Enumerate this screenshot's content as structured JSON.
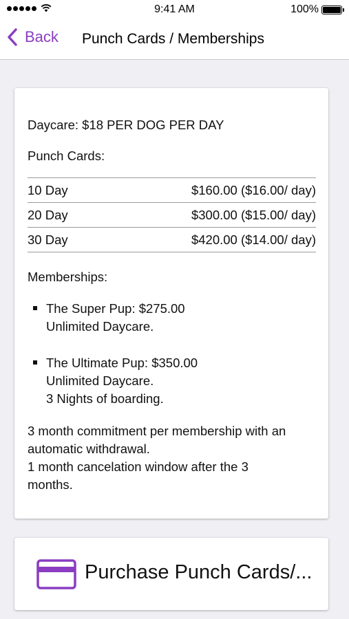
{
  "status_bar": {
    "time": "9:41 AM",
    "battery": "100%"
  },
  "nav": {
    "back_label": "Back",
    "title": "Punch Cards / Memberships"
  },
  "card": {
    "daycare_rate": "Daycare: $18 PER DOG PER DAY",
    "punch_heading": "Punch Cards:",
    "punch_cards": [
      {
        "label": "10 Day",
        "price": "$160.00 ($16.00/ day)"
      },
      {
        "label": "20 Day",
        "price": "$300.00 ($15.00/ day)"
      },
      {
        "label": "30 Day",
        "price": "$420.00 ($14.00/ day)"
      }
    ],
    "memberships_heading": "Memberships:",
    "memberships": [
      {
        "name": "The Super Pup: $275.00",
        "lines": [
          "Unlimited Daycare."
        ]
      },
      {
        "name": "The Ultimate Pup: $350.00",
        "lines": [
          "Unlimited Daycare.",
          "3 Nights of boarding."
        ]
      }
    ],
    "commitment_lines": [
      "3 month commitment per membership with an",
      "automatic withdrawal.",
      "1 month cancelation window after the 3",
      "months."
    ]
  },
  "purchase": {
    "label": "Purchase Punch Cards/..."
  },
  "colors": {
    "accent": "#8a3dc1",
    "background": "#efeff4"
  },
  "icons": {
    "back": "chevron-left-icon",
    "purchase": "credit-card-icon"
  }
}
